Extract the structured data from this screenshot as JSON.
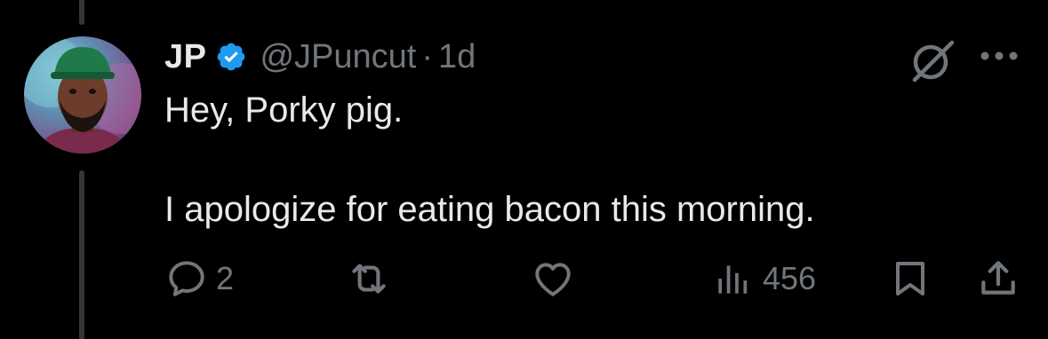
{
  "tweet": {
    "display_name": "JP",
    "handle": "@JPuncut",
    "separator": "·",
    "time": "1d",
    "text_line1": "Hey, Porky pig.",
    "text_line2": "I apologize for eating bacon this morning.",
    "verified": true
  },
  "actions": {
    "reply_count": "2",
    "retweet_count": "",
    "like_count": "",
    "views_count": "456"
  },
  "icons": {
    "verified": "verified-badge-icon",
    "grok": "grok-icon",
    "more": "more-icon",
    "reply": "reply-icon",
    "retweet": "retweet-icon",
    "like": "heart-icon",
    "views": "views-chart-icon",
    "bookmark": "bookmark-icon",
    "share": "share-icon"
  },
  "colors": {
    "background": "#000000",
    "text_primary": "#e7e9ea",
    "text_secondary": "#71767b",
    "verified_blue": "#1d9bf0",
    "thread_line": "#333639"
  }
}
